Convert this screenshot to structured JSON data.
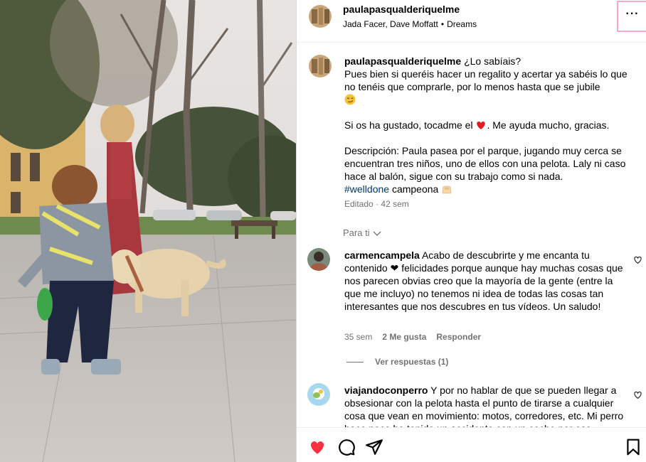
{
  "post": {
    "username": "paulapasqualderiquelme",
    "audio_artists": "Jada Facer, Dave Moffatt",
    "audio_separator": "•",
    "audio_title": "Dreams",
    "more_options_label": "···"
  },
  "caption": {
    "username": "paulapasqualderiquelme",
    "line1": "¿Lo sabíais?",
    "line2": "Pues bien si queréis hacer un regalito y acertar ya sabéis lo que no tenéis que comprarle, por lo menos hasta que se jubile",
    "para2": "Si os ha gustado, tocadme el",
    "para2_end": ". Me ayuda mucho, gracias.",
    "para3": "Descripción: Paula pasea por el parque, jugando muy cerca se encuentran tres niños, uno de ellos con una pelota. Laly ni caso hace al balón, sigue con su trabajo como si nada.",
    "hashtag": "#welldone",
    "after_hashtag": " campeona",
    "edited": "Editado",
    "sep": "·",
    "time": "42 sem"
  },
  "see_translation": "Para ti",
  "comments": [
    {
      "username": "carmencampela",
      "text": "Acabo de descubrirte y me encanta tu contenido ❤ felicidades porque aunque hay muchas cosas que nos parecen obvias creo que la mayoría de la gente (entre la que me incluyo) no tenemos ni idea de todas las cosas tan interesantes que nos descubres en tus vídeos. Un saludo!",
      "time": "35 sem",
      "likes": "2 Me gusta",
      "reply": "Responder",
      "view_replies": "Ver respuestas (1)"
    },
    {
      "username": "viajandoconperro",
      "text": "Y por no hablar de que se pueden llegar a obsesionar con la pelota hasta el punto de tirarse a cualquier cosa que vean en movimiento: motos, corredores, etc. Mi perro hace poco ha tenido un accidente con un coche por eso"
    }
  ],
  "colors": {
    "like_red": "#ff3040",
    "hashtag_blue": "#00376b",
    "meta_gray": "#737373",
    "highlight_pink": "#f7a8d0"
  },
  "icons": [
    "heart-filled-icon",
    "comment-icon",
    "share-icon",
    "bookmark-icon",
    "more-options-icon",
    "chevron-down-icon",
    "heart-outline-icon"
  ]
}
